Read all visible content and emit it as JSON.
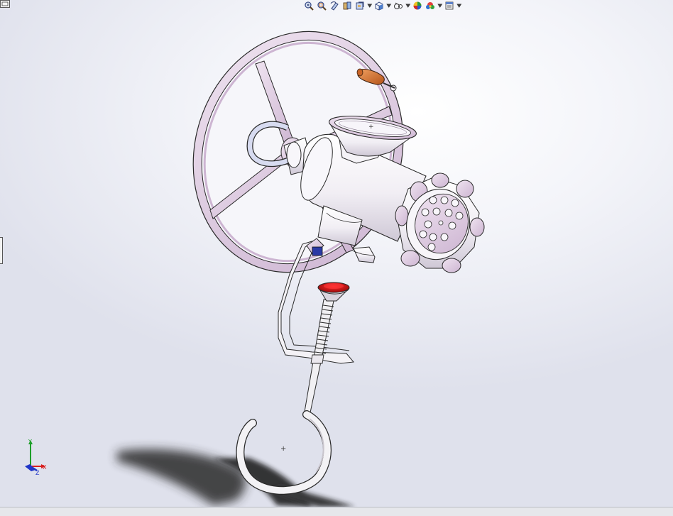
{
  "app": {
    "window": "SolidWorks graphics viewport",
    "model": "meat grinder assembly"
  },
  "toolbar": {
    "items": [
      {
        "name": "zoom-to-fit-icon",
        "dropdown": false
      },
      {
        "name": "zoom-to-area-icon",
        "dropdown": false
      },
      {
        "name": "previous-view-icon",
        "dropdown": false
      },
      {
        "name": "section-view-icon",
        "dropdown": false
      },
      {
        "name": "dynamic-annotation-views-icon",
        "dropdown": true
      },
      {
        "name": "view-orientation-icon",
        "dropdown": true
      },
      {
        "name": "display-style-icon",
        "dropdown": true
      },
      {
        "name": "hide-show-items-icon",
        "dropdown": true
      },
      {
        "name": "apply-scene-icon",
        "dropdown": true
      },
      {
        "name": "view-settings-icon",
        "dropdown": true
      }
    ]
  },
  "triad": {
    "x_label": "X",
    "y_label": "Y",
    "z_label": "Z",
    "colors": {
      "x": "#d81e1e",
      "y": "#1e9e2a",
      "z": "#1f35c8"
    }
  },
  "colors": {
    "part_lilac": "#e7d6ea",
    "part_edge": "#2a2a2a",
    "handle": "#d7742a",
    "plunger_top": "#d81818",
    "bolt_blue": "#2b3aa5",
    "shadow": "#1c1c1c"
  }
}
